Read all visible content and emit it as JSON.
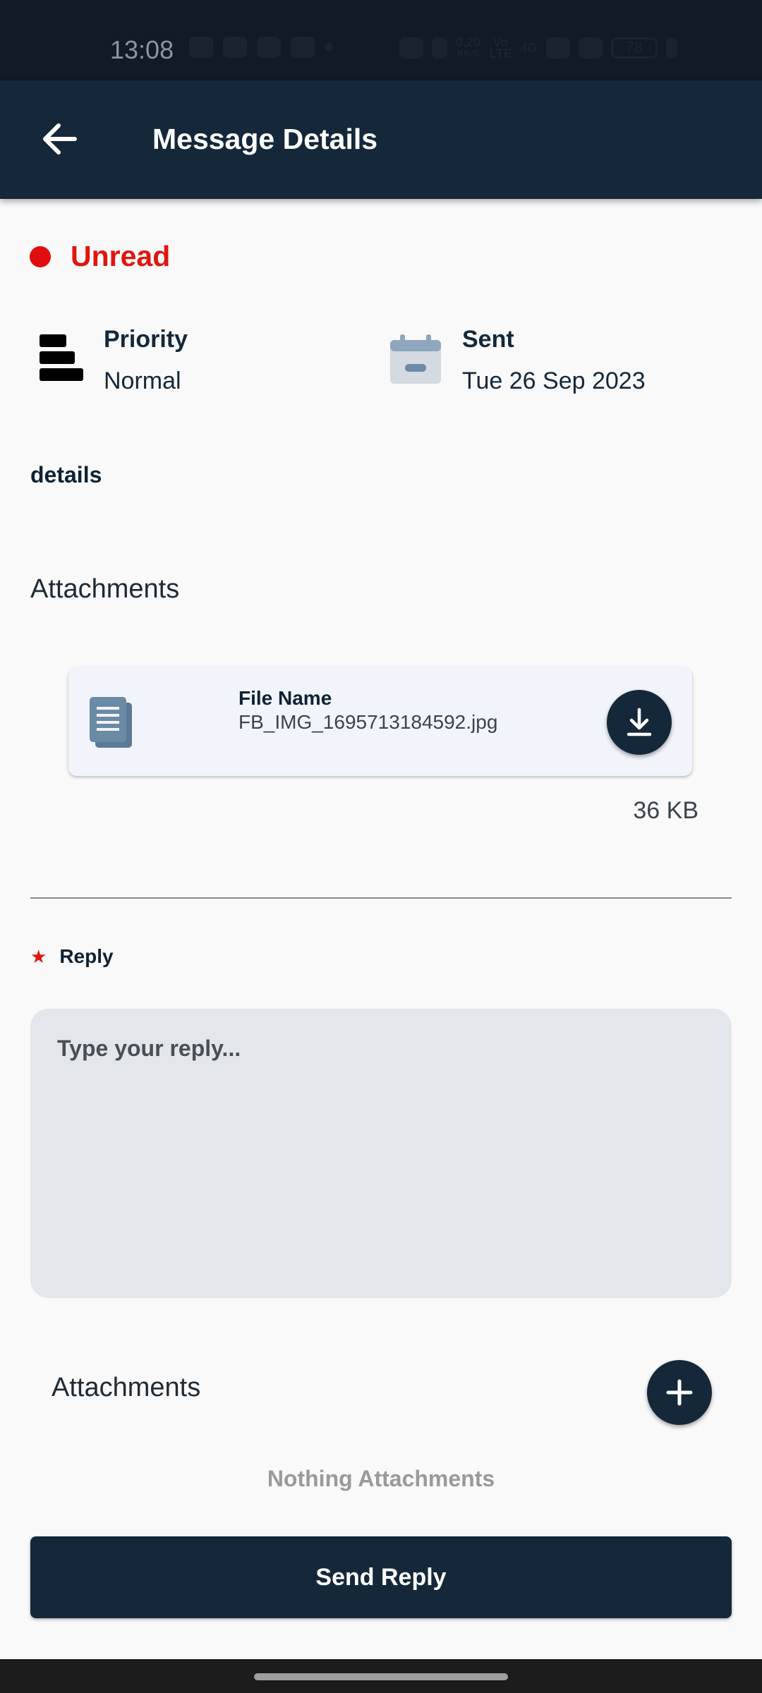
{
  "status_bar": {
    "time": "13:08",
    "net_speed_top": "0.20",
    "net_speed_bottom": "KB/S",
    "volte_top": "Vo",
    "volte_bottom": "LTE",
    "network_type": "4G",
    "battery": "78"
  },
  "app_bar": {
    "title": "Message Details"
  },
  "message": {
    "status": "Unread",
    "priority_label": "Priority",
    "priority_value": "Normal",
    "sent_label": "Sent",
    "sent_value": "Tue 26 Sep 2023",
    "details": "details"
  },
  "attachments": {
    "title": "Attachments",
    "items": [
      {
        "file_name_label": "File Name",
        "file_name": "FB_IMG_1695713184592.jpg",
        "size": "36 KB"
      }
    ]
  },
  "reply": {
    "required_mark": "★",
    "label": "Reply",
    "placeholder": "Type your reply...",
    "attachments_title": "Attachments",
    "empty_attachments": "Nothing Attachments",
    "send_label": "Send Reply"
  },
  "colors": {
    "primary": "#14283a",
    "unread": "#e0160e",
    "card_bg": "#f1f4fb"
  }
}
